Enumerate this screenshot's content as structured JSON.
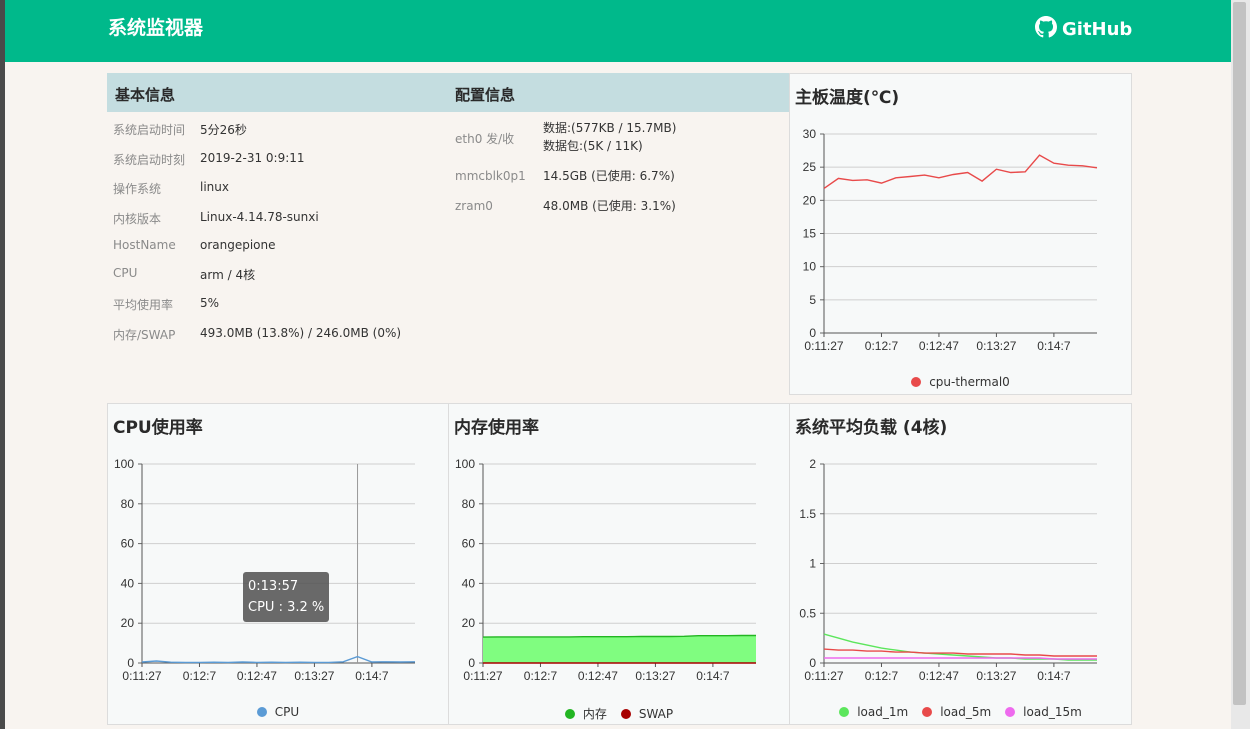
{
  "header": {
    "title": "系统监视器",
    "github_label": "GitHub"
  },
  "basic_info": {
    "title": "基本信息",
    "rows": [
      {
        "label": "系统启动时间",
        "value": "5分26秒"
      },
      {
        "label": "系统启动时刻",
        "value": "2019-2-31 0:9:11"
      },
      {
        "label": "操作系统",
        "value": "linux"
      },
      {
        "label": "内核版本",
        "value": "Linux-4.14.78-sunxi"
      },
      {
        "label": "HostName",
        "value": "orangepione"
      },
      {
        "label": "CPU",
        "value": "arm / 4核"
      },
      {
        "label": "平均使用率",
        "value": "5%"
      },
      {
        "label": "内存/SWAP",
        "value": "493.0MB (13.8%) / 246.0MB (0%)"
      }
    ]
  },
  "config_info": {
    "title": "配置信息",
    "rows": [
      {
        "label": "eth0 发/收",
        "value": "数据:(577KB / 15.7MB)",
        "value2": "数据包:(5K / 11K)"
      },
      {
        "label": "mmcblk0p1",
        "value": "14.5GB (已使用: 6.7%)"
      },
      {
        "label": "zram0",
        "value": "48.0MB (已使用: 3.1%)"
      }
    ]
  },
  "tooltip": {
    "time": "0:13:57",
    "text": "CPU : 3.2 %"
  },
  "chart_data": [
    {
      "id": "temp",
      "type": "line",
      "title": "主板温度(℃)",
      "x_tick_labels": [
        "0:11:27",
        "0:12:7",
        "0:12:47",
        "0:13:27",
        "0:14:7"
      ],
      "ylim": [
        0,
        30
      ],
      "y_ticks": [
        0,
        5,
        10,
        15,
        20,
        25,
        30
      ],
      "grid": true,
      "legend_placement": "bottom",
      "series": [
        {
          "name": "cpu-thermal0",
          "color": "#e84a4a",
          "values": [
            21.8,
            23.3,
            23.0,
            23.1,
            22.6,
            23.4,
            23.6,
            23.8,
            23.4,
            23.9,
            24.2,
            22.9,
            24.7,
            24.2,
            24.3,
            26.8,
            25.6,
            25.3,
            25.2,
            24.9
          ]
        }
      ]
    },
    {
      "id": "cpu",
      "type": "area",
      "title": "CPU使用率",
      "x_tick_labels": [
        "0:11:27",
        "0:12:7",
        "0:12:47",
        "0:13:27",
        "0:14:7"
      ],
      "ylim": [
        0,
        100
      ],
      "y_ticks": [
        0,
        20,
        40,
        60,
        80,
        100
      ],
      "grid": true,
      "legend_placement": "bottom",
      "series": [
        {
          "name": "CPU",
          "color": "#5b9bd5",
          "values": [
            0.5,
            1.0,
            0.4,
            0.3,
            0.3,
            0.4,
            0.3,
            0.5,
            0.3,
            0.4,
            0.3,
            0.4,
            0.3,
            0.3,
            0.6,
            3.2,
            0.5,
            0.6,
            0.5,
            0.6
          ]
        }
      ]
    },
    {
      "id": "mem",
      "type": "area",
      "title": "内存使用率",
      "x_tick_labels": [
        "0:11:27",
        "0:12:7",
        "0:12:47",
        "0:13:27",
        "0:14:7"
      ],
      "ylim": [
        0,
        100
      ],
      "y_ticks": [
        0,
        20,
        40,
        60,
        80,
        100
      ],
      "grid": true,
      "legend_placement": "bottom",
      "series": [
        {
          "name": "内存",
          "color": "#22b522",
          "fill": "#80fd80",
          "values": [
            13.0,
            13.1,
            13.1,
            13.1,
            13.1,
            13.1,
            13.1,
            13.2,
            13.2,
            13.2,
            13.2,
            13.3,
            13.3,
            13.3,
            13.4,
            13.7,
            13.7,
            13.7,
            13.8,
            13.8
          ]
        },
        {
          "name": "SWAP",
          "color": "#a80000",
          "values": [
            0,
            0,
            0,
            0,
            0,
            0,
            0,
            0,
            0,
            0,
            0,
            0,
            0,
            0,
            0,
            0,
            0,
            0,
            0,
            0
          ]
        }
      ]
    },
    {
      "id": "load",
      "type": "line",
      "title": "系统平均负载 (4核)",
      "x_tick_labels": [
        "0:11:27",
        "0:12:7",
        "0:12:47",
        "0:13:27",
        "0:14:7"
      ],
      "ylim": [
        0,
        2
      ],
      "y_ticks": [
        0,
        0.5,
        1,
        1.5,
        2
      ],
      "grid": true,
      "legend_placement": "bottom",
      "series": [
        {
          "name": "load_1m",
          "color": "#5ce65c",
          "values": [
            0.29,
            0.25,
            0.21,
            0.18,
            0.15,
            0.13,
            0.11,
            0.1,
            0.09,
            0.08,
            0.07,
            0.06,
            0.05,
            0.05,
            0.04,
            0.04,
            0.04,
            0.03,
            0.03,
            0.03
          ]
        },
        {
          "name": "load_5m",
          "color": "#e84a4a",
          "values": [
            0.14,
            0.13,
            0.13,
            0.12,
            0.12,
            0.11,
            0.11,
            0.1,
            0.1,
            0.1,
            0.09,
            0.09,
            0.09,
            0.09,
            0.08,
            0.08,
            0.07,
            0.07,
            0.07,
            0.07
          ]
        },
        {
          "name": "load_15m",
          "color": "#ee6aee",
          "values": [
            0.05,
            0.05,
            0.05,
            0.05,
            0.05,
            0.05,
            0.05,
            0.05,
            0.05,
            0.05,
            0.05,
            0.05,
            0.05,
            0.05,
            0.05,
            0.05,
            0.04,
            0.04,
            0.04,
            0.04
          ]
        }
      ]
    }
  ]
}
